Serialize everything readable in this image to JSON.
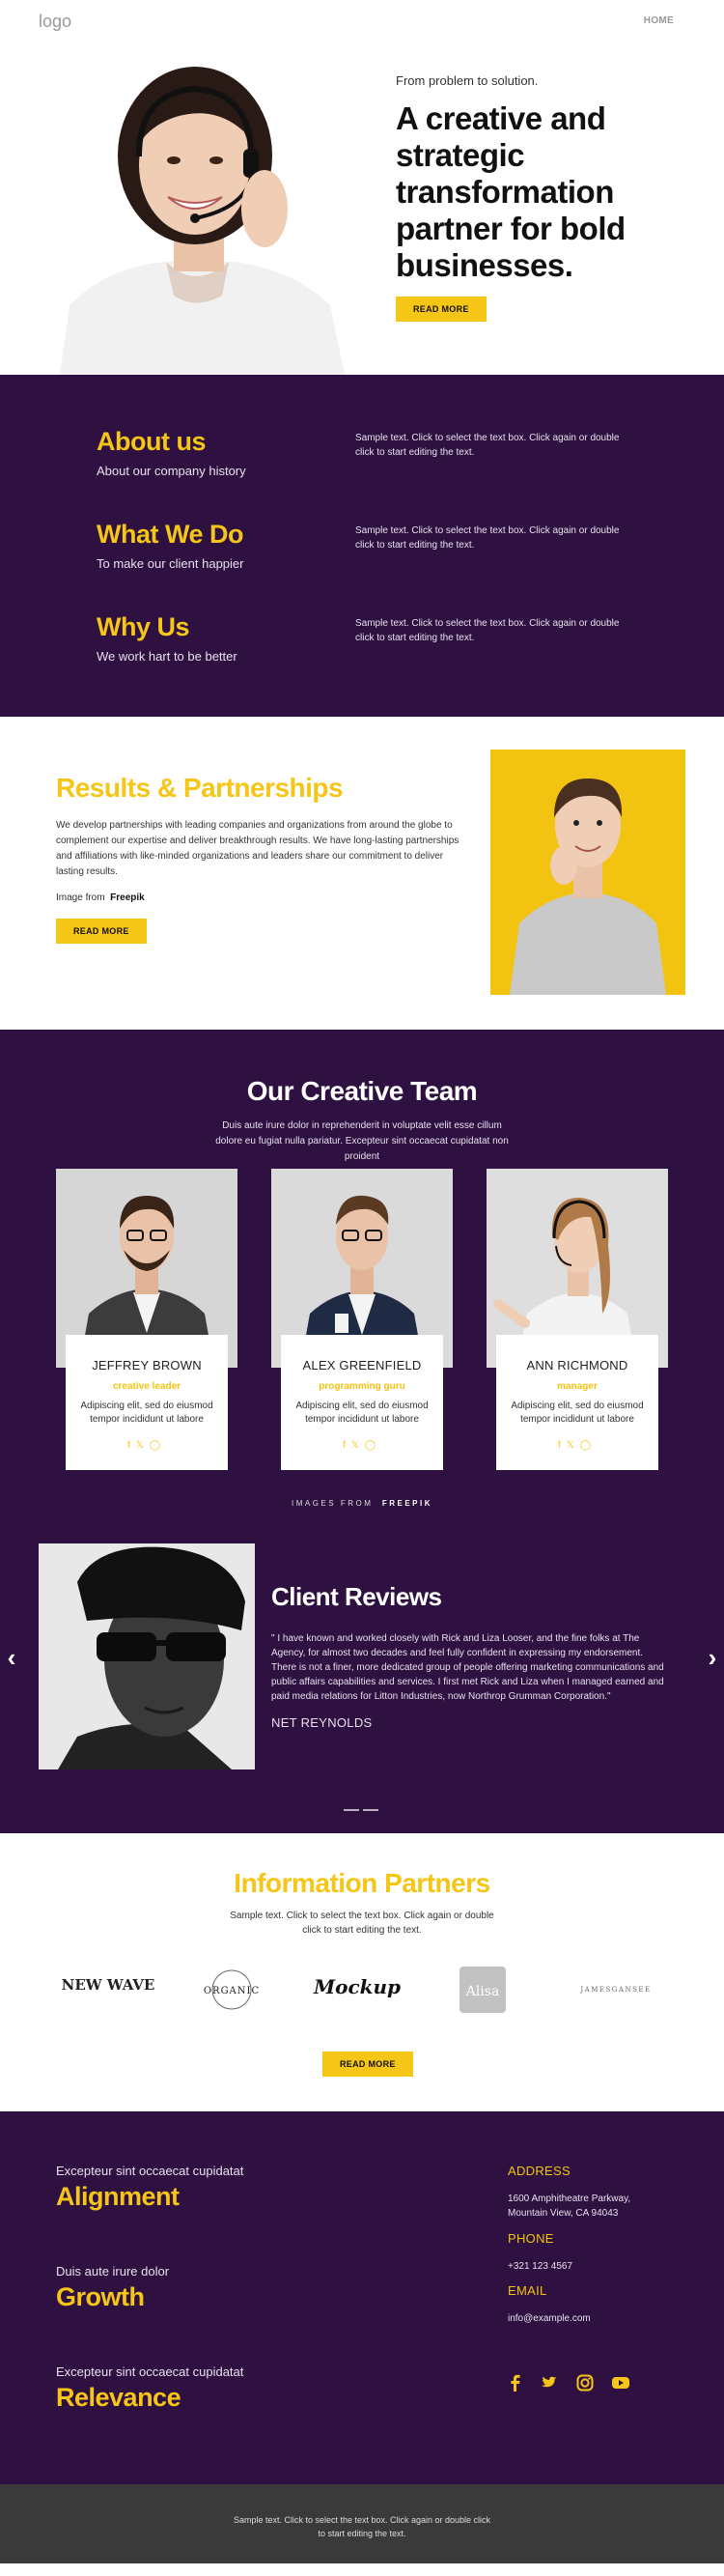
{
  "header": {
    "logo": "logo",
    "nav_home": "HOME"
  },
  "hero": {
    "subtitle": "From problem to solution.",
    "title": "A creative and strategic transformation partner for bold businesses.",
    "button": "READ MORE"
  },
  "about": {
    "items": [
      {
        "title": "About us",
        "subtitle": "About our company history",
        "text": "Sample text. Click to select the text box. Click again or double click to start editing the text."
      },
      {
        "title": "What We Do",
        "subtitle": "To make our client happier",
        "text": "Sample text. Click to select the text box. Click again or double click to start editing the text."
      },
      {
        "title": "Why Us",
        "subtitle": "We work hart to be better",
        "text": "Sample text. Click to select the text box. Click again or double click to start editing the text."
      }
    ]
  },
  "results": {
    "title": "Results & Partnerships",
    "text": "We develop partnerships with leading companies and organizations from around the globe to complement our expertise and deliver breakthrough results. We have long-lasting partnerships and affiliations with like-minded organizations and leaders share our commitment to deliver lasting results.",
    "credit_prefix": "Image from",
    "credit_source": "Freepik",
    "button": "READ MORE"
  },
  "team": {
    "title": "Our Creative Team",
    "description": "Duis aute irure dolor in reprehenderit in voluptate velit esse cillum dolore eu fugiat nulla pariatur. Excepteur sint occaecat cupidatat non proident",
    "members": [
      {
        "name": "JEFFREY BROWN",
        "role": "creative leader",
        "text": "Adipiscing elit, sed do eiusmod tempor incididunt ut labore"
      },
      {
        "name": "ALEX GREENFIELD",
        "role": "programming guru",
        "text": "Adipiscing elit, sed do eiusmod tempor incididunt ut labore"
      },
      {
        "name": "ANN RICHMOND",
        "role": "manager",
        "text": "Adipiscing elit, sed do eiusmod tempor incididunt ut labore"
      }
    ],
    "credit_prefix": "IMAGES FROM",
    "credit_source": "FREEPIK"
  },
  "reviews": {
    "title": "Client Reviews",
    "quote": "\" I have known and worked closely with Rick and Liza Looser, and the fine folks at The Agency, for almost two decades and feel fully confident in expressing my endorsement. There is not a finer, more dedicated group of people offering marketing communications and public affairs capabilities and services. I first met Rick and Liza when I managed earned and paid media relations for Litton Industries, now Northrop Grumman Corporation.\"",
    "author": "NET REYNOLDS"
  },
  "partners": {
    "title": "Information Partners",
    "text": "Sample text. Click to select the text box. Click again or double click to start editing the text.",
    "logos": [
      "NEW WAVE",
      "ORGANIC",
      "Mockup",
      "Alisa",
      "JAMESGANSEE"
    ],
    "button": "READ MORE"
  },
  "footer": {
    "blocks": [
      {
        "kicker": "Excepteur sint occaecat cupidatat",
        "title": "Alignment"
      },
      {
        "kicker": "Duis aute irure dolor",
        "title": "Growth"
      },
      {
        "kicker": "Excepteur sint occaecat cupidatat",
        "title": "Relevance"
      }
    ],
    "address_label": "ADDRESS",
    "address_line1": "1600 Amphitheatre Parkway,",
    "address_line2": "Mountain View, CA 94043",
    "phone_label": "PHONE",
    "phone": "+321 123 4567",
    "email_label": "EMAIL",
    "email": "info@example.com"
  },
  "bottom": {
    "text": "Sample text. Click to select the text box. Click again or double click to start editing the text."
  },
  "colors": {
    "purple": "#2e1140",
    "yellow": "#f5c518",
    "dark": "#3a3a3a"
  }
}
